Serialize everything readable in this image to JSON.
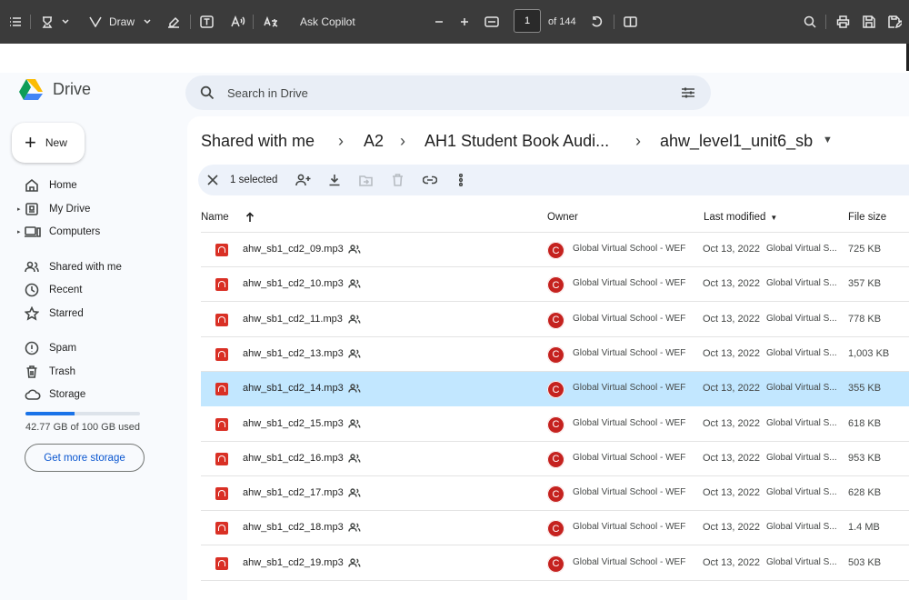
{
  "pdf_toolbar": {
    "draw_label": "Draw",
    "copilot_label": "Ask Copilot",
    "page_current": "1",
    "page_total": "of 144"
  },
  "drive": {
    "logo_text": "Drive",
    "new_label": "New",
    "nav": [
      {
        "label": "Home",
        "icon": "home-icon"
      },
      {
        "label": "My Drive",
        "icon": "my-drive-icon"
      },
      {
        "label": "Computers",
        "icon": "computers-icon"
      },
      {
        "label": "Shared with me",
        "icon": "shared-icon"
      },
      {
        "label": "Recent",
        "icon": "clock-icon"
      },
      {
        "label": "Starred",
        "icon": "star-icon"
      },
      {
        "label": "Spam",
        "icon": "spam-icon"
      },
      {
        "label": "Trash",
        "icon": "trash-icon"
      },
      {
        "label": "Storage",
        "icon": "cloud-icon"
      }
    ],
    "storage_used_fraction": 0.4277,
    "storage_text": "42.77 GB of 100 GB used",
    "get_storage_label": "Get more storage",
    "search_placeholder": "Search in Drive",
    "breadcrumb": [
      "Shared with me",
      "A2",
      "AH1 Student Book Audi...",
      "ahw_level1_unit6_sb"
    ],
    "selection": {
      "count_label": "1 selected"
    },
    "columns": {
      "name": "Name",
      "owner": "Owner",
      "modified": "Last modified",
      "size": "File size"
    },
    "files": [
      {
        "name": "ahw_sb1_cd2_09.mp3",
        "owner": "Global Virtual School - WEF",
        "owner_initial": "C",
        "date": "Oct 13, 2022",
        "by": "Global Virtual S...",
        "size": "725 KB",
        "selected": false
      },
      {
        "name": "ahw_sb1_cd2_10.mp3",
        "owner": "Global Virtual School - WEF",
        "owner_initial": "C",
        "date": "Oct 13, 2022",
        "by": "Global Virtual S...",
        "size": "357 KB",
        "selected": false
      },
      {
        "name": "ahw_sb1_cd2_11.mp3",
        "owner": "Global Virtual School - WEF",
        "owner_initial": "C",
        "date": "Oct 13, 2022",
        "by": "Global Virtual S...",
        "size": "778 KB",
        "selected": false
      },
      {
        "name": "ahw_sb1_cd2_13.mp3",
        "owner": "Global Virtual School - WEF",
        "owner_initial": "C",
        "date": "Oct 13, 2022",
        "by": "Global Virtual S...",
        "size": "1,003 KB",
        "selected": false
      },
      {
        "name": "ahw_sb1_cd2_14.mp3",
        "owner": "Global Virtual School - WEF",
        "owner_initial": "C",
        "date": "Oct 13, 2022",
        "by": "Global Virtual S...",
        "size": "355 KB",
        "selected": true
      },
      {
        "name": "ahw_sb1_cd2_15.mp3",
        "owner": "Global Virtual School - WEF",
        "owner_initial": "C",
        "date": "Oct 13, 2022",
        "by": "Global Virtual S...",
        "size": "618 KB",
        "selected": false
      },
      {
        "name": "ahw_sb1_cd2_16.mp3",
        "owner": "Global Virtual School - WEF",
        "owner_initial": "C",
        "date": "Oct 13, 2022",
        "by": "Global Virtual S...",
        "size": "953 KB",
        "selected": false
      },
      {
        "name": "ahw_sb1_cd2_17.mp3",
        "owner": "Global Virtual School - WEF",
        "owner_initial": "C",
        "date": "Oct 13, 2022",
        "by": "Global Virtual S...",
        "size": "628 KB",
        "selected": false
      },
      {
        "name": "ahw_sb1_cd2_18.mp3",
        "owner": "Global Virtual School - WEF",
        "owner_initial": "C",
        "date": "Oct 13, 2022",
        "by": "Global Virtual S...",
        "size": "1.4 MB",
        "selected": false
      },
      {
        "name": "ahw_sb1_cd2_19.mp3",
        "owner": "Global Virtual School - WEF",
        "owner_initial": "C",
        "date": "Oct 13, 2022",
        "by": "Global Virtual S...",
        "size": "503 KB",
        "selected": false
      }
    ]
  }
}
